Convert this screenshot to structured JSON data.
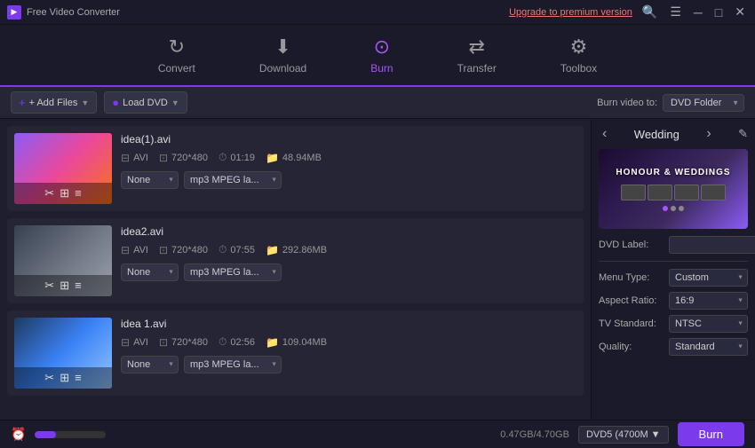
{
  "titleBar": {
    "appName": "Free Video Converter",
    "upgradeText": "Upgrade to premium version",
    "searchIcon": "🔍",
    "menuIcon": "☰",
    "minimizeIcon": "─",
    "maximizeIcon": "□",
    "closeIcon": "✕"
  },
  "nav": {
    "items": [
      {
        "id": "convert",
        "label": "Convert",
        "icon": "↻",
        "active": false
      },
      {
        "id": "download",
        "label": "Download",
        "icon": "⬇",
        "active": false
      },
      {
        "id": "burn",
        "label": "Burn",
        "icon": "⊙",
        "active": true
      },
      {
        "id": "transfer",
        "label": "Transfer",
        "icon": "⇄",
        "active": false
      },
      {
        "id": "toolbox",
        "label": "Toolbox",
        "icon": "⚙",
        "active": false
      }
    ]
  },
  "toolbar": {
    "addFilesLabel": "+ Add Files",
    "loadDvdLabel": "Load DVD",
    "burnVideoToLabel": "Burn video to:",
    "burnDestOption": "DVD Folder"
  },
  "files": [
    {
      "id": "file1",
      "name": "idea(1).avi",
      "format": "AVI",
      "resolution": "720*480",
      "duration": "01:19",
      "size": "48.94MB",
      "audioOption": "None",
      "audioFormat": "mp3 MPEG la..."
    },
    {
      "id": "file2",
      "name": "idea2.avi",
      "format": "AVI",
      "resolution": "720*480",
      "duration": "07:55",
      "size": "292.86MB",
      "audioOption": "None",
      "audioFormat": "mp3 MPEG la..."
    },
    {
      "id": "file3",
      "name": "idea 1.avi",
      "format": "AVI",
      "resolution": "720*480",
      "duration": "02:56",
      "size": "109.04MB",
      "audioOption": "None",
      "audioFormat": "mp3 MPEG la..."
    }
  ],
  "rightPanel": {
    "title": "Wedding",
    "previewText": "HONOUR & WEDDINGS",
    "form": {
      "dvdLabel": "DVD Label:",
      "menuTypeLabel": "Menu Type:",
      "menuTypeValue": "Custom",
      "aspectRatioLabel": "Aspect Ratio:",
      "aspectRatioValue": "16:9",
      "tvStandardLabel": "TV Standard:",
      "tvStandardValue": "NTSC",
      "qualityLabel": "Quality:",
      "qualityValue": "Standard"
    }
  },
  "statusBar": {
    "storageUsed": "0.47GB/4.70GB",
    "dvdSize": "DVD5 (4700M",
    "burnLabel": "Burn",
    "progressPercent": 30
  }
}
